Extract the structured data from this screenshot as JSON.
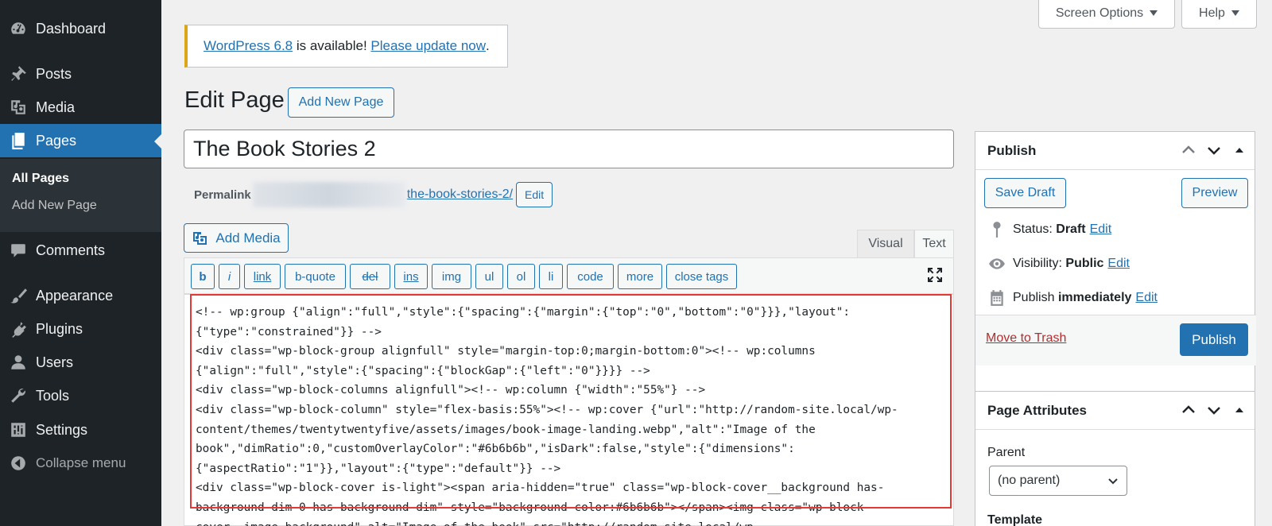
{
  "sidebar": {
    "items": [
      {
        "label": "Dashboard",
        "icon": "dashboard-icon"
      },
      {
        "label": "Posts",
        "icon": "pushpin-icon"
      },
      {
        "label": "Media",
        "icon": "media-icon"
      },
      {
        "label": "Pages",
        "icon": "pages-icon"
      },
      {
        "label": "Comments",
        "icon": "comment-icon"
      },
      {
        "label": "Appearance",
        "icon": "paintbrush-icon"
      },
      {
        "label": "Plugins",
        "icon": "plugin-icon"
      },
      {
        "label": "Users",
        "icon": "user-icon"
      },
      {
        "label": "Tools",
        "icon": "wrench-icon"
      },
      {
        "label": "Settings",
        "icon": "settings-icon"
      }
    ],
    "submenu": [
      "All Pages",
      "Add New Page"
    ],
    "collapse": "Collapse menu"
  },
  "top": {
    "screen_options": "Screen Options",
    "help": "Help"
  },
  "notice": {
    "version_link": "WordPress 6.8",
    "middle": " is available! ",
    "update_link": "Please update now",
    "end": "."
  },
  "page": {
    "heading": "Edit Page",
    "add_new": "Add New Page",
    "title": "The Book Stories 2",
    "permalink_label": "Permalink",
    "permalink_slug": "the-book-stories-2/",
    "permalink_edit": "Edit"
  },
  "editor": {
    "add_media": "Add Media",
    "tab_visual": "Visual",
    "tab_text": "Text",
    "quicktags": [
      "b",
      "i",
      "link",
      "b-quote",
      "del",
      "ins",
      "img",
      "ul",
      "ol",
      "li",
      "code",
      "more",
      "close tags"
    ],
    "content": "<!-- wp:group {\"align\":\"full\",\"style\":{\"spacing\":{\"margin\":{\"top\":\"0\",\"bottom\":\"0\"}}},\"layout\":\n{\"type\":\"constrained\"}} -->\n<div class=\"wp-block-group alignfull\" style=\"margin-top:0;margin-bottom:0\"><!-- wp:columns\n{\"align\":\"full\",\"style\":{\"spacing\":{\"blockGap\":{\"left\":\"0\"}}}} -->\n<div class=\"wp-block-columns alignfull\"><!-- wp:column {\"width\":\"55%\"} -->\n<div class=\"wp-block-column\" style=\"flex-basis:55%\"><!-- wp:cover {\"url\":\"http://random-site.local/wp-\ncontent/themes/twentytwentyfive/assets/images/book-image-landing.webp\",\"alt\":\"Image of the\nbook\",\"dimRatio\":0,\"customOverlayColor\":\"#6b6b6b\",\"isDark\":false,\"style\":{\"dimensions\":\n{\"aspectRatio\":\"1\"}},\"layout\":{\"type\":\"default\"}} -->\n<div class=\"wp-block-cover is-light\"><span aria-hidden=\"true\" class=\"wp-block-cover__background has-\nbackground-dim-0 has-background-dim\" style=\"background-color:#6b6b6b\"></span><img class=\"wp-block-\ncover__image-background\" alt=\"Image of the book\" src=\"http://random-site.local/wp-"
  },
  "publish": {
    "title": "Publish",
    "save_draft": "Save Draft",
    "preview": "Preview",
    "status_label": "Status:",
    "status_value": "Draft",
    "visibility_label": "Visibility:",
    "visibility_value": "Public",
    "publish_label": "Publish",
    "publish_value": "immediately",
    "edit": "Edit",
    "trash": "Move to Trash",
    "publish_button": "Publish"
  },
  "attributes": {
    "title": "Page Attributes",
    "parent_label": "Parent",
    "parent_value": "(no parent)",
    "template_label": "Template"
  },
  "colors": {
    "accent": "#2271b1",
    "sidebar": "#1d2327",
    "notice": "#dba617",
    "trash": "#b32d2e",
    "highlight": "#e53935"
  }
}
